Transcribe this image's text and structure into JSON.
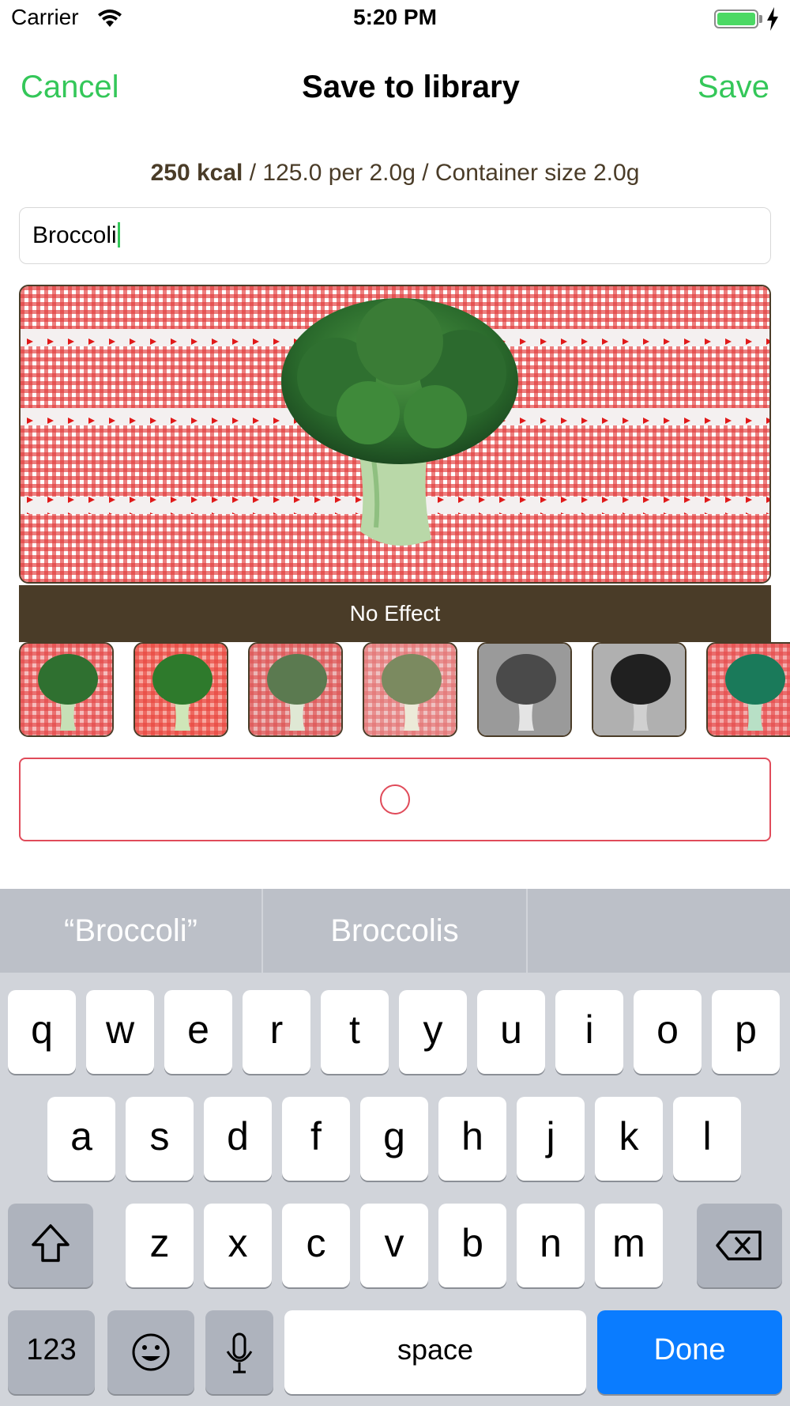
{
  "status_bar": {
    "carrier": "Carrier",
    "time": "5:20 PM",
    "battery_level": 1.0
  },
  "nav": {
    "cancel": "Cancel",
    "title": "Save to library",
    "save": "Save"
  },
  "nutrition": {
    "kcal": "250 kcal",
    "detail": " / 125.0 per 2.0g / Container size 2.0g"
  },
  "name_field": {
    "value": "Broccoli"
  },
  "photo": {
    "effect_label": "No Effect"
  },
  "thumbnails": [
    {
      "name": "no-effect"
    },
    {
      "name": "warm"
    },
    {
      "name": "faded"
    },
    {
      "name": "pale"
    },
    {
      "name": "mono"
    },
    {
      "name": "noir"
    },
    {
      "name": "cool"
    }
  ],
  "keyboard": {
    "suggestions": [
      "“Broccoli”",
      "Broccolis",
      ""
    ],
    "row1": [
      "q",
      "w",
      "e",
      "r",
      "t",
      "y",
      "u",
      "i",
      "o",
      "p"
    ],
    "row2": [
      "a",
      "s",
      "d",
      "f",
      "g",
      "h",
      "j",
      "k",
      "l"
    ],
    "row3": [
      "z",
      "x",
      "c",
      "v",
      "b",
      "n",
      "m"
    ],
    "numbers": "123",
    "space": "space",
    "done": "Done"
  },
  "colors": {
    "accent": "#34c759",
    "brown": "#4a3c28",
    "red": "#e04b5a",
    "done": "#0a7cff"
  }
}
